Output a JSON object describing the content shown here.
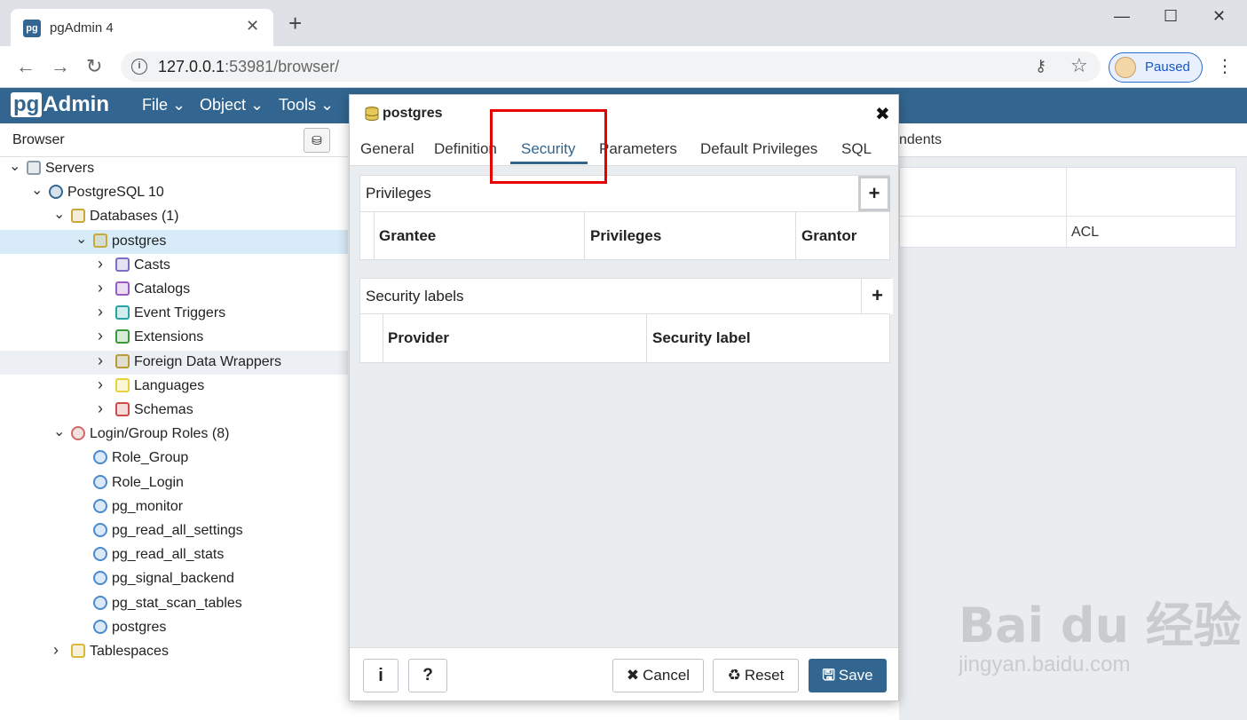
{
  "browser": {
    "tab_title": "pgAdmin 4",
    "tab_favicon": "pg",
    "url_host": "127.0.0.1",
    "url_rest": ":53981/browser/",
    "profile_label": "Paused"
  },
  "app": {
    "logo_box": "pg",
    "logo_text": "Admin",
    "menus": [
      "File",
      "Object",
      "Tools"
    ]
  },
  "browser_panel": {
    "title": "Browser",
    "tree": [
      {
        "label": "Servers",
        "icon": "servers-icon",
        "caret": "expanded"
      },
      {
        "label": "PostgreSQL 10",
        "icon": "elephant-icon",
        "caret": "expanded"
      },
      {
        "label": "Databases (1)",
        "icon": "databases-icon",
        "caret": "expanded"
      },
      {
        "label": "postgres",
        "icon": "database-icon",
        "caret": "expanded",
        "state": "selected"
      },
      {
        "label": "Casts",
        "icon": "casts-icon",
        "caret": "collapsed"
      },
      {
        "label": "Catalogs",
        "icon": "catalogs-icon",
        "caret": "collapsed"
      },
      {
        "label": "Event Triggers",
        "icon": "event-triggers-icon",
        "caret": "collapsed"
      },
      {
        "label": "Extensions",
        "icon": "extensions-icon",
        "caret": "collapsed"
      },
      {
        "label": "Foreign Data Wrappers",
        "icon": "fdw-icon",
        "caret": "collapsed",
        "state": "hover"
      },
      {
        "label": "Languages",
        "icon": "languages-icon",
        "caret": "collapsed"
      },
      {
        "label": "Schemas",
        "icon": "schemas-icon",
        "caret": "collapsed"
      },
      {
        "label": "Login/Group Roles (8)",
        "icon": "roles-icon",
        "caret": "expanded"
      },
      {
        "label": "Role_Group",
        "icon": "group-role-icon",
        "caret": "none"
      },
      {
        "label": "Role_Login",
        "icon": "login-role-icon",
        "caret": "none"
      },
      {
        "label": "pg_monitor",
        "icon": "group-role-icon",
        "caret": "none"
      },
      {
        "label": "pg_read_all_settings",
        "icon": "group-role-icon",
        "caret": "none"
      },
      {
        "label": "pg_read_all_stats",
        "icon": "group-role-icon",
        "caret": "none"
      },
      {
        "label": "pg_signal_backend",
        "icon": "group-role-icon",
        "caret": "none"
      },
      {
        "label": "pg_stat_scan_tables",
        "icon": "group-role-icon",
        "caret": "none"
      },
      {
        "label": "postgres",
        "icon": "login-role-icon",
        "caret": "none"
      },
      {
        "label": "Tablespaces",
        "icon": "tablespaces-icon",
        "caret": "collapsed"
      }
    ]
  },
  "right_panel": {
    "tab_partial": "ndents",
    "cell_acl": "ACL"
  },
  "dialog": {
    "title": "postgres",
    "tabs": [
      "General",
      "Definition",
      "Security",
      "Parameters",
      "Default Privileges",
      "SQL"
    ],
    "active_tab": "Security",
    "privileges": {
      "title": "Privileges",
      "add": "+",
      "columns": [
        "Grantee",
        "Privileges",
        "Grantor"
      ]
    },
    "security_labels": {
      "title": "Security labels",
      "add": "+",
      "columns": [
        "Provider",
        "Security label"
      ]
    },
    "footer": {
      "info": "i",
      "help": "?",
      "cancel": "Cancel",
      "reset": "Reset",
      "save": "Save"
    }
  },
  "watermark": {
    "main": "Bai du 经验",
    "sub": "jingyan.baidu.com"
  },
  "colors": {
    "pg_blue": "#326690",
    "highlight": "#e60000",
    "selected_row": "#d8ebf8"
  }
}
